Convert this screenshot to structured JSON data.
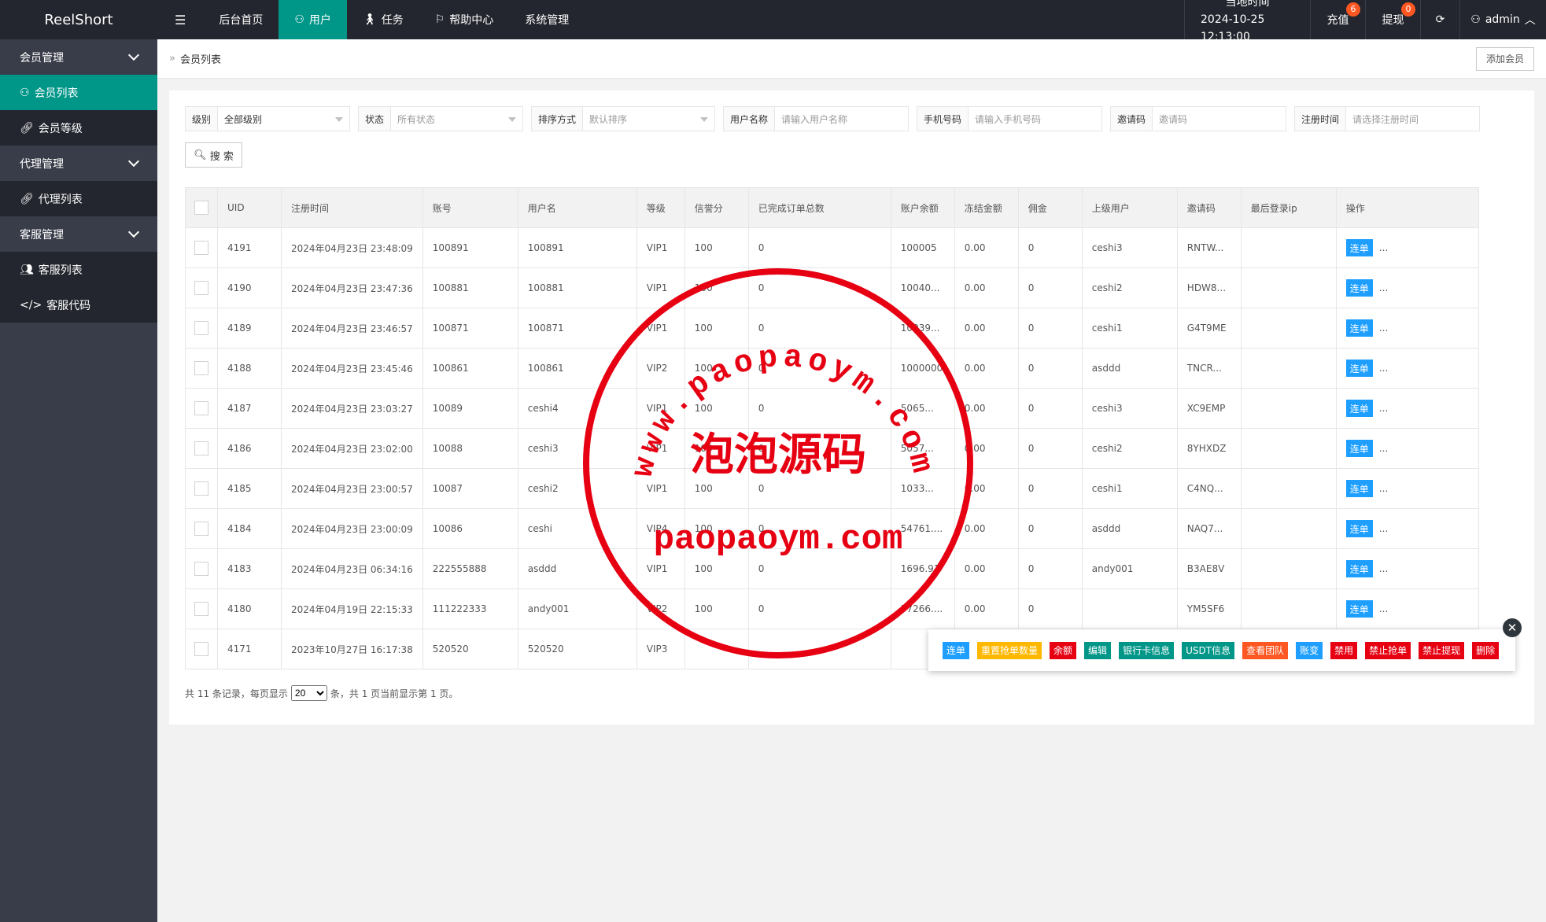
{
  "app": {
    "title": "ReelShort"
  },
  "topnav": {
    "items": [
      {
        "label": "后台首页",
        "icon": ""
      },
      {
        "label": "用户",
        "icon": "user-icon"
      },
      {
        "label": "任务",
        "icon": "person-walk-icon"
      },
      {
        "label": "帮助中心",
        "icon": "flag-icon"
      },
      {
        "label": "系统管理",
        "icon": ""
      }
    ],
    "active_index": 1
  },
  "topright": {
    "time_label": "当地时间",
    "time_value": "2024-10-25 12:13:00",
    "recharge_label": "充值",
    "recharge_badge": "6",
    "withdraw_label": "提现",
    "withdraw_badge": "0",
    "user_label": "admin"
  },
  "sidebar": {
    "groups": [
      {
        "label": "会员管理",
        "items": [
          {
            "label": "会员列表",
            "icon": "user-icon",
            "active": true
          },
          {
            "label": "会员等级",
            "icon": "link-icon",
            "active": false
          }
        ]
      },
      {
        "label": "代理管理",
        "items": [
          {
            "label": "代理列表",
            "icon": "link-icon",
            "active": false
          }
        ]
      },
      {
        "label": "客服管理",
        "items": [
          {
            "label": "客服列表",
            "icon": "users-icon",
            "active": false
          },
          {
            "label": "客服代码",
            "icon": "code-icon",
            "active": false
          }
        ]
      }
    ]
  },
  "breadcrumb": {
    "sep": "»",
    "current": "会员列表"
  },
  "add_button": "添加会员",
  "filters": {
    "level": {
      "label": "级别",
      "value": "全部级别"
    },
    "status": {
      "label": "状态",
      "value": "所有状态"
    },
    "sort": {
      "label": "排序方式",
      "value": "默认排序"
    },
    "username": {
      "label": "用户名称",
      "placeholder": "请输入用户名称"
    },
    "phone": {
      "label": "手机号码",
      "placeholder": "请输入手机号码"
    },
    "invite": {
      "label": "邀请码",
      "placeholder": "邀请码"
    },
    "regtime": {
      "label": "注册时间",
      "placeholder": "请选择注册时间"
    },
    "search_label": "搜 索"
  },
  "table": {
    "headers": [
      "UID",
      "注册时间",
      "账号",
      "用户名",
      "等级",
      "信誉分",
      "已完成订单总数",
      "账户余额",
      "冻结金额",
      "佣金",
      "上级用户",
      "邀请码",
      "最后登录ip",
      "操作"
    ],
    "rows": [
      [
        "4191",
        "2024年04月23日 23:48:09",
        "100891",
        "100891",
        "VIP1",
        "100",
        "0",
        "100005",
        "0.00",
        "0",
        "ceshi3",
        "RNTW...",
        ""
      ],
      [
        "4190",
        "2024年04月23日 23:47:36",
        "100881",
        "100881",
        "VIP1",
        "100",
        "0",
        "10040...",
        "0.00",
        "0",
        "ceshi2",
        "HDW8...",
        ""
      ],
      [
        "4189",
        "2024年04月23日 23:46:57",
        "100871",
        "100871",
        "VIP1",
        "100",
        "0",
        "10039...",
        "0.00",
        "0",
        "ceshi1",
        "G4T9ME",
        ""
      ],
      [
        "4188",
        "2024年04月23日 23:45:46",
        "100861",
        "100861",
        "VIP2",
        "100",
        "0",
        "1000000",
        "0.00",
        "0",
        "asddd",
        "TNCR...",
        ""
      ],
      [
        "4187",
        "2024年04月23日 23:03:27",
        "10089",
        "ceshi4",
        "VIP1",
        "100",
        "0",
        "5065...",
        "0.00",
        "0",
        "ceshi3",
        "XC9EMP",
        ""
      ],
      [
        "4186",
        "2024年04月23日 23:02:00",
        "10088",
        "ceshi3",
        "VIP1",
        "100",
        "0",
        "5057...",
        "0.00",
        "0",
        "ceshi2",
        "8YHXDZ",
        ""
      ],
      [
        "4185",
        "2024年04月23日 23:00:57",
        "10087",
        "ceshi2",
        "VIP1",
        "100",
        "0",
        "1033...",
        "0.00",
        "0",
        "ceshi1",
        "C4NQ...",
        ""
      ],
      [
        "4184",
        "2024年04月23日 23:00:09",
        "10086",
        "ceshi",
        "VIP4",
        "100",
        "0",
        "54761....",
        "0.00",
        "0",
        "asddd",
        "NAQ7...",
        ""
      ],
      [
        "4183",
        "2024年04月23日 06:34:16",
        "222555888",
        "asddd",
        "VIP1",
        "100",
        "0",
        "1696.91",
        "0.00",
        "0",
        "andy001",
        "B3AE8V",
        ""
      ],
      [
        "4180",
        "2024年04月19日 22:15:33",
        "111222333",
        "andy001",
        "VIP2",
        "100",
        "0",
        "57266....",
        "0.00",
        "0",
        "",
        "YM5SF6",
        ""
      ],
      [
        "4171",
        "2023年10月27日 16:17:38",
        "520520",
        "520520",
        "VIP3",
        "",
        "",
        "",
        "",
        "",
        "",
        "",
        ""
      ]
    ],
    "op_button": "连单",
    "op_more": "..."
  },
  "pager": {
    "prefix": "共 11 条记录，每页显示",
    "page_size": "20",
    "suffix": "条，共 1 页当前显示第 1 页。"
  },
  "popup": {
    "actions": [
      {
        "label": "连单",
        "color": "#1e9fff"
      },
      {
        "label": "重置抢单数量",
        "color": "#ffb800"
      },
      {
        "label": "余额",
        "color": "#e60012"
      },
      {
        "label": "编辑",
        "color": "#009688"
      },
      {
        "label": "银行卡信息",
        "color": "#009688"
      },
      {
        "label": "USDT信息",
        "color": "#009688"
      },
      {
        "label": "查看团队",
        "color": "#ff5722"
      },
      {
        "label": "账变",
        "color": "#1e9fff"
      },
      {
        "label": "禁用",
        "color": "#e60012"
      },
      {
        "label": "禁止抢单",
        "color": "#e60012"
      },
      {
        "label": "禁止提现",
        "color": "#e60012"
      },
      {
        "label": "删除",
        "color": "#e60012"
      }
    ]
  },
  "watermark": {
    "top_arc": "www.paopaoym.com",
    "center": "泡泡源码",
    "bottom": "paopaoym.com",
    "color": "#e60012"
  }
}
